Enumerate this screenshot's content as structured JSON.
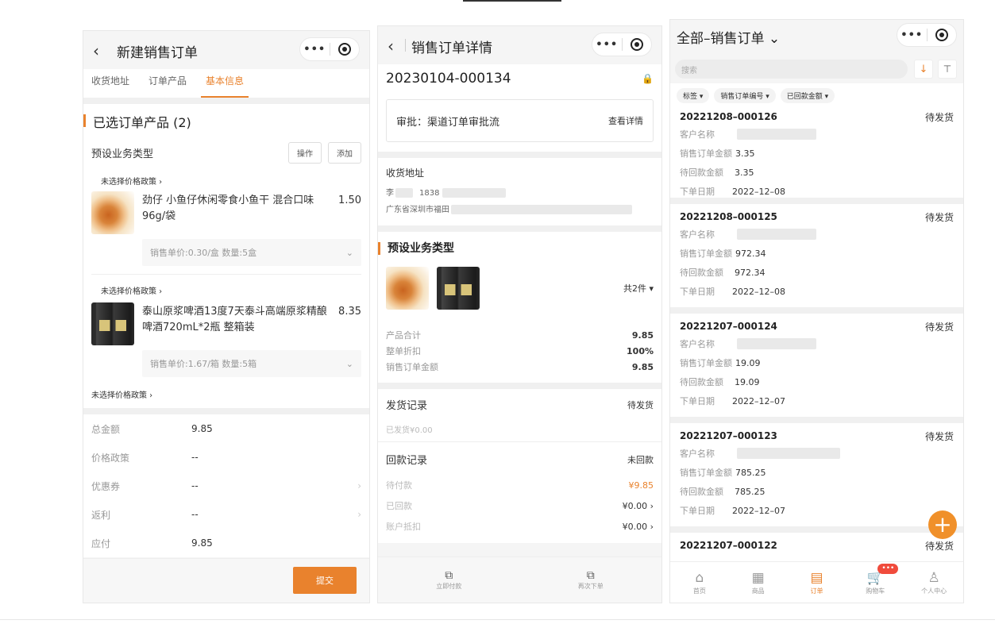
{
  "p1": {
    "title": "新建销售订单",
    "back": "‹",
    "tabs": [
      "收货地址",
      "订单产品",
      "基本信息"
    ],
    "selected_title": "已选订单产品 (2)",
    "biz_type": "预设业务类型",
    "btn_op": "操作",
    "btn_add": "添加",
    "policy1": "未选择价格政策 ›",
    "prod1_name": "劲仔 小鱼仔休闲零食小鱼干 混合口味 96g/袋",
    "prod1_price": "1.50",
    "prod1_spec": "销售单价:0.30/盒   数量:5盒",
    "policy2": "未选择价格政策 ›",
    "prod2_name": "泰山原浆啤酒13度7天泰斗高端原浆精酿啤酒720mL*2瓶 整箱装",
    "prod2_price": "8.35",
    "prod2_spec": "销售单价:1.67/箱   数量:5箱",
    "policy3": "未选择价格政策 ›",
    "kv": [
      {
        "k": "总金额",
        "v": "9.85",
        "ch": ""
      },
      {
        "k": "价格政策",
        "v": "--",
        "ch": ""
      },
      {
        "k": "优惠券",
        "v": "--",
        "ch": "›"
      },
      {
        "k": "返利",
        "v": "--",
        "ch": "›"
      },
      {
        "k": "应付",
        "v": "9.85",
        "ch": ""
      }
    ],
    "submit": "提交"
  },
  "p2": {
    "title": "销售订单详情",
    "back": "‹",
    "order_no": "20230104-000134",
    "approval": "审批：渠道订单审批流",
    "approval_link": "查看详情",
    "addr_title": "收货地址",
    "addr_name": "李",
    "addr_phone": "1838",
    "addr_line": "广东省深圳市福田",
    "biz_type": "预设业务类型",
    "count": "共2件 ▾",
    "sums": [
      {
        "k": "产品合计",
        "v": "9.85"
      },
      {
        "k": "整单折扣",
        "v": "100%"
      },
      {
        "k": "销售订单金额",
        "v": "9.85"
      }
    ],
    "ship_title": "发货记录",
    "ship_status": "待发货",
    "ship_sub": "已发货¥0.00",
    "pay_title": "回款记录",
    "pay_status": "未回款",
    "pay_rows": [
      {
        "k": "待付款",
        "v": "¥9.85"
      },
      {
        "k": "已回款",
        "v": "¥0.00 ›"
      },
      {
        "k": "账户抵扣",
        "v": "¥0.00 ›"
      }
    ],
    "footer_btn1": "立即付款",
    "footer_btn2": "再次下单"
  },
  "p3": {
    "title": "全部–销售订单 ⌄",
    "search_placeholder": "搜索",
    "chips": [
      "标签 ▾",
      "销售订单编号 ▾",
      "已回款金额 ▾"
    ],
    "labels": {
      "customer": "客户名称",
      "amount": "销售订单金额",
      "receivable": "待回款金额",
      "date": "下单日期"
    },
    "orders": [
      {
        "no": "20221208–000126",
        "status": "待发货",
        "amount": "3.35",
        "receivable": "3.35",
        "date": "2022–12–08"
      },
      {
        "no": "20221208–000125",
        "status": "待发货",
        "amount": "972.34",
        "receivable": "972.34",
        "date": "2022–12–08"
      },
      {
        "no": "20221207–000124",
        "status": "待发货",
        "amount": "19.09",
        "receivable": "19.09",
        "date": "2022–12–07"
      },
      {
        "no": "20221207–000123",
        "status": "待发货",
        "amount": "785.25",
        "receivable": "785.25",
        "date": "2022–12–07"
      },
      {
        "no": "20221207–000122",
        "status": "待发货",
        "amount": "",
        "receivable": "",
        "date": ""
      }
    ],
    "tabbar": [
      {
        "label": "首页",
        "icon": "⌂"
      },
      {
        "label": "商品",
        "icon": "▦"
      },
      {
        "label": "订单",
        "icon": "▤"
      },
      {
        "label": "购物车",
        "icon": "🛒",
        "badge": "•••"
      },
      {
        "label": "个人中心",
        "icon": "♙"
      }
    ],
    "fab": "+"
  },
  "colors": {
    "accent": "#e9822d",
    "badge": "#f04b3c"
  }
}
